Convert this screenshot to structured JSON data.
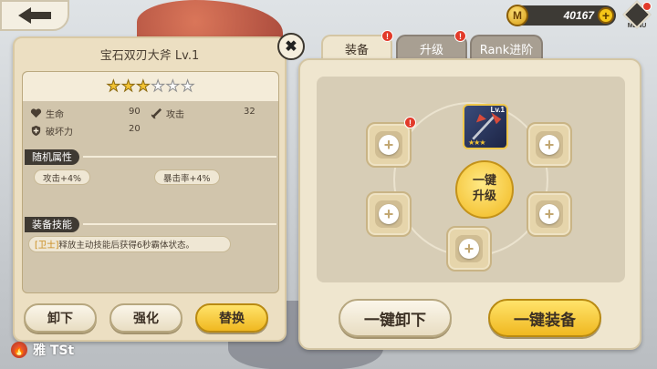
{
  "currency": {
    "icon": "coin-icon",
    "badge": "M",
    "amount": "40167",
    "add": "+"
  },
  "menu": {
    "label": "MENU"
  },
  "item": {
    "title": "宝石双刃大斧 Lv.1",
    "stars_filled": 3,
    "stars_total": 6,
    "stats": [
      {
        "label": "生命",
        "value": "90"
      },
      {
        "label": "攻击",
        "value": "32"
      },
      {
        "label": "破坏力",
        "value": "20"
      }
    ],
    "random_attr_title": "随机属性",
    "random_attrs": [
      "攻击+4%",
      "暴击率+4%"
    ],
    "skill_title": "装备技能",
    "skill_tag": "[卫士]",
    "skill_text": "释放主动技能后获得6秒霸体状态。",
    "buttons": {
      "unequip": "卸下",
      "enhance": "强化",
      "replace": "替换"
    }
  },
  "tabs": [
    {
      "label": "装备",
      "active": true,
      "badge": "!"
    },
    {
      "label": "升级",
      "active": false,
      "badge": "!"
    },
    {
      "label": "Rank进阶",
      "active": false
    }
  ],
  "equip": {
    "weapon_level": "Lv.1",
    "center_button_line1": "一键",
    "center_button_line2": "升级",
    "slot_badge": "!",
    "btn_unequip_all": "一键卸下",
    "btn_equip_all": "一键装备"
  },
  "hud": {
    "name": "雅 TSt"
  },
  "colors": {
    "accent_gold": "#f1b81e",
    "panel": "#ecdfc2",
    "badge_red": "#e23a2a"
  }
}
